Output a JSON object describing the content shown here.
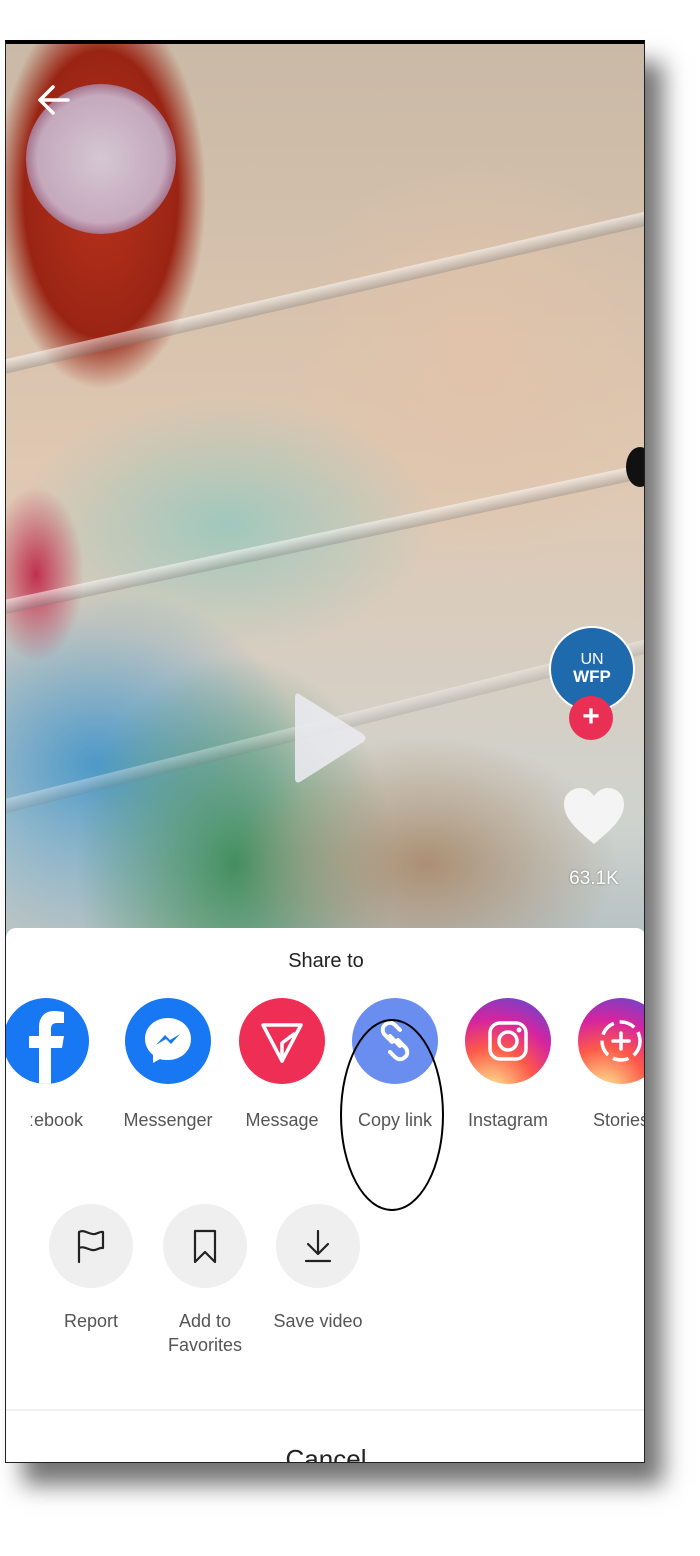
{
  "video": {
    "back_icon": "arrow-left-icon",
    "play_icon": "play-icon"
  },
  "creator": {
    "avatar_line1": "UN",
    "avatar_line2": "WFP",
    "follow_symbol": "+"
  },
  "engagement": {
    "like_icon": "heart-icon",
    "like_count": "63.1K"
  },
  "share_sheet": {
    "title": "Share to",
    "share_targets": [
      {
        "label": "Facebook",
        "visible_label": "ːebook",
        "icon": "facebook-icon",
        "color": "#1877f2"
      },
      {
        "label": "Messenger",
        "icon": "messenger-icon",
        "color": "#1877f2"
      },
      {
        "label": "Message",
        "icon": "message-send-icon",
        "color": "#ef2e55"
      },
      {
        "label": "Copy link",
        "icon": "link-icon",
        "color": "#6a8ef0",
        "highlighted": true
      },
      {
        "label": "Instagram",
        "icon": "instagram-icon",
        "color": "#d6249f"
      },
      {
        "label": "Stories",
        "icon": "stories-add-icon",
        "color": "#d6249f"
      }
    ],
    "actions": [
      {
        "label": "Report",
        "icon": "flag-icon"
      },
      {
        "label": "Add to Favorites",
        "line1": "Add to",
        "line2": "Favorites",
        "icon": "bookmark-icon"
      },
      {
        "label": "Save video",
        "icon": "download-icon"
      }
    ],
    "cancel_label": "Cancel"
  },
  "colors": {
    "follow_red": "#ea2f55",
    "avatar_blue": "#1f6aad",
    "action_bg": "#efefef"
  }
}
